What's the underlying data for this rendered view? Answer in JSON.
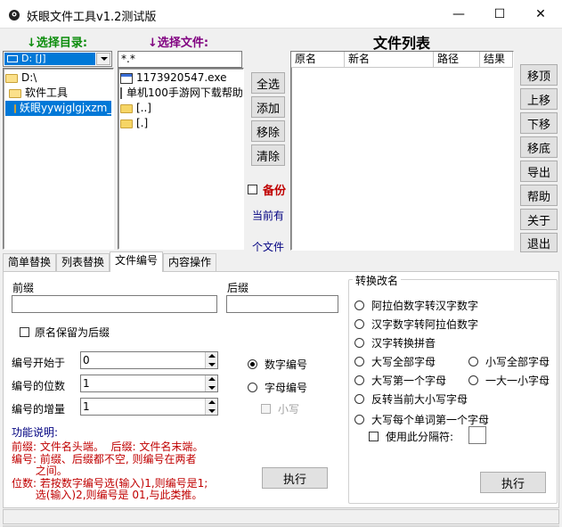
{
  "window": {
    "title": "妖眼文件工具v1.2测试版",
    "minimize": "—",
    "maximize": "☐",
    "close": "✕"
  },
  "left": {
    "dir_label": "↓选择目录:",
    "file_label": "↓选择文件:",
    "drive": "D: [J]",
    "filter": "*.*",
    "tree": [
      "D:\\",
      "软件工具",
      "妖眼yywjglgjxzm_d"
    ],
    "files": [
      "1173920547.exe",
      "单机100手游网下载帮助",
      "[..]",
      "[.]"
    ]
  },
  "middle": {
    "select_all": "全选",
    "add": "添加",
    "remove": "移除",
    "clear": "清除",
    "backup": "备份",
    "current_count": "当前有",
    "file_count_suffix": "个文件"
  },
  "file_list": {
    "title": "文件列表",
    "columns": [
      "原名",
      "新名",
      "路径",
      "结果"
    ]
  },
  "right_buttons": [
    "移顶",
    "上移",
    "下移",
    "移底",
    "导出",
    "帮助",
    "关于",
    "退出"
  ],
  "tabs": [
    "简单替换",
    "列表替换",
    "文件编号",
    "内容操作"
  ],
  "numbering": {
    "prefix_label": "前缀",
    "suffix_label": "后缀",
    "keep_name_as_suffix": "原名保留为后缀",
    "start_label": "编号开始于",
    "start_value": "0",
    "digits_label": "编号的位数",
    "digits_value": "1",
    "increment_label": "编号的增量",
    "increment_value": "1",
    "numeric_option": "数字编号",
    "alpha_option": "字母编号",
    "lowercase_option": "小写",
    "help_title": "功能说明:",
    "help_lines": [
      "前缀: 文件名头端。  后缀: 文件名末端。",
      "编号: 前缀、后缀都不空, 则编号在两者",
      "       之间。",
      "位数: 若按数字编号选(输入)1,则编号是1;",
      "       选(输入)2,则编号是 01,与此类推。"
    ],
    "execute": "执行"
  },
  "convert": {
    "group_title": "转换改名",
    "options": [
      "阿拉伯数字转汉字数字",
      "汉字数字转阿拉伯数字",
      "汉字转换拼音",
      "大写全部字母",
      "小写全部字母",
      "大写第一个字母",
      "一大一小字母",
      "反转当前大小写字母",
      "大写每个单词第一个字母"
    ],
    "separator_label": "使用此分隔符:",
    "execute": "执行"
  }
}
